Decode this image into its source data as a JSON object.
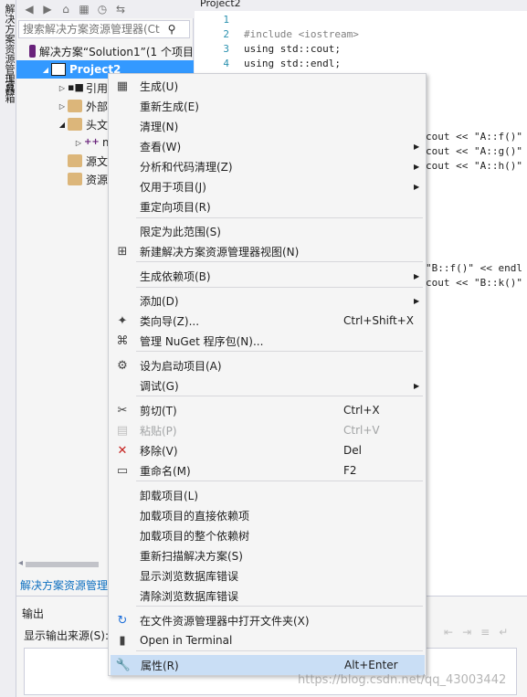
{
  "left_strip": {
    "panel1": "解决方案资源管理器",
    "panel2": "工具箱"
  },
  "solution_explorer": {
    "search_placeholder": "搜索解决方案资源管理器(Ct",
    "search_icon": "search-icon",
    "tree": [
      {
        "label": "解决方案“Solution1”(1 个项目",
        "level": 0,
        "icon": "solution-icon",
        "expanded": null
      },
      {
        "label": "Project2",
        "level": 1,
        "icon": "project-icon",
        "expanded": true,
        "selected": true
      },
      {
        "label": "引用",
        "level": 2,
        "icon": "references-icon",
        "expanded": false
      },
      {
        "label": "外部依",
        "level": 2,
        "icon": "external-deps-icon",
        "expanded": false
      },
      {
        "label": "头文件",
        "level": 2,
        "icon": "folder-icon",
        "expanded": true
      },
      {
        "label": "m",
        "level": 3,
        "icon": "cpp-file-icon",
        "expanded": false
      },
      {
        "label": "源文件",
        "level": 2,
        "icon": "folder-icon",
        "expanded": null
      },
      {
        "label": "资源文",
        "level": 2,
        "icon": "folder-icon",
        "expanded": null
      }
    ],
    "bottom_tab": "解决方案资源管理"
  },
  "editor": {
    "tab_label": "Project2",
    "lines": [
      {
        "n": "1",
        "text": ""
      },
      {
        "n": "2",
        "text": "#include <iostream>"
      },
      {
        "n": "3",
        "text": "using std::cout;"
      },
      {
        "n": "4",
        "text": "using std::endl;"
      }
    ],
    "fragments": [
      "cout << \"A::f()\"",
      "cout << \"A::g()\"",
      "cout << \"A::h()\"",
      "\"B::f()\" << endl",
      "cout << \"B::k()\""
    ]
  },
  "output": {
    "title": "输出",
    "source_label": "显示输出来源(S):"
  },
  "context_menu": {
    "items": [
      {
        "label": "生成(U)",
        "key": "",
        "icon": "build-icon",
        "submenu": false
      },
      {
        "label": "重新生成(E)",
        "key": "",
        "icon": "",
        "submenu": false
      },
      {
        "label": "清理(N)",
        "key": "",
        "icon": "",
        "submenu": false
      },
      {
        "label": "查看(W)",
        "key": "",
        "icon": "",
        "submenu": true
      },
      {
        "label": "分析和代码清理(Z)",
        "key": "",
        "icon": "",
        "submenu": true
      },
      {
        "label": "仅用于项目(J)",
        "key": "",
        "icon": "",
        "submenu": true
      },
      {
        "label": "重定向项目(R)",
        "key": "",
        "icon": "",
        "submenu": false
      },
      {
        "label": "限定为此范围(S)",
        "key": "",
        "icon": "",
        "submenu": false
      },
      {
        "label": "新建解决方案资源管理器视图(N)",
        "key": "",
        "icon": "new-view-icon",
        "submenu": false
      },
      {
        "label": "生成依赖项(B)",
        "key": "",
        "icon": "",
        "submenu": true
      },
      {
        "label": "添加(D)",
        "key": "",
        "icon": "",
        "submenu": true
      },
      {
        "label": "类向导(Z)...",
        "key": "Ctrl+Shift+X",
        "icon": "class-wizard-icon",
        "submenu": false
      },
      {
        "label": "管理 NuGet 程序包(N)...",
        "key": "",
        "icon": "nuget-icon",
        "submenu": false
      },
      {
        "label": "设为启动项目(A)",
        "key": "",
        "icon": "gear-icon",
        "submenu": false
      },
      {
        "label": "调试(G)",
        "key": "",
        "icon": "",
        "submenu": true
      },
      {
        "label": "剪切(T)",
        "key": "Ctrl+X",
        "icon": "scissors-icon",
        "submenu": false
      },
      {
        "label": "粘贴(P)",
        "key": "Ctrl+V",
        "icon": "paste-icon",
        "submenu": false,
        "disabled": true
      },
      {
        "label": "移除(V)",
        "key": "Del",
        "icon": "remove-icon",
        "submenu": false
      },
      {
        "label": "重命名(M)",
        "key": "F2",
        "icon": "rename-icon",
        "submenu": false
      },
      {
        "label": "卸载项目(L)",
        "key": "",
        "icon": "",
        "submenu": false
      },
      {
        "label": "加载项目的直接依赖项",
        "key": "",
        "icon": "",
        "submenu": false
      },
      {
        "label": "加载项目的整个依赖树",
        "key": "",
        "icon": "",
        "submenu": false
      },
      {
        "label": "重新扫描解决方案(S)",
        "key": "",
        "icon": "",
        "submenu": false
      },
      {
        "label": "显示浏览数据库错误",
        "key": "",
        "icon": "",
        "submenu": false
      },
      {
        "label": "清除浏览数据库错误",
        "key": "",
        "icon": "",
        "submenu": false
      },
      {
        "label": "在文件资源管理器中打开文件夹(X)",
        "key": "",
        "icon": "open-folder-icon",
        "submenu": false
      },
      {
        "label": "Open in Terminal",
        "key": "",
        "icon": "terminal-icon",
        "submenu": false
      },
      {
        "label": "属性(R)",
        "key": "Alt+Enter",
        "icon": "wrench-icon",
        "submenu": false,
        "highlighted": true
      }
    ]
  },
  "watermark": "https://blog.csdn.net/qq_43003442"
}
